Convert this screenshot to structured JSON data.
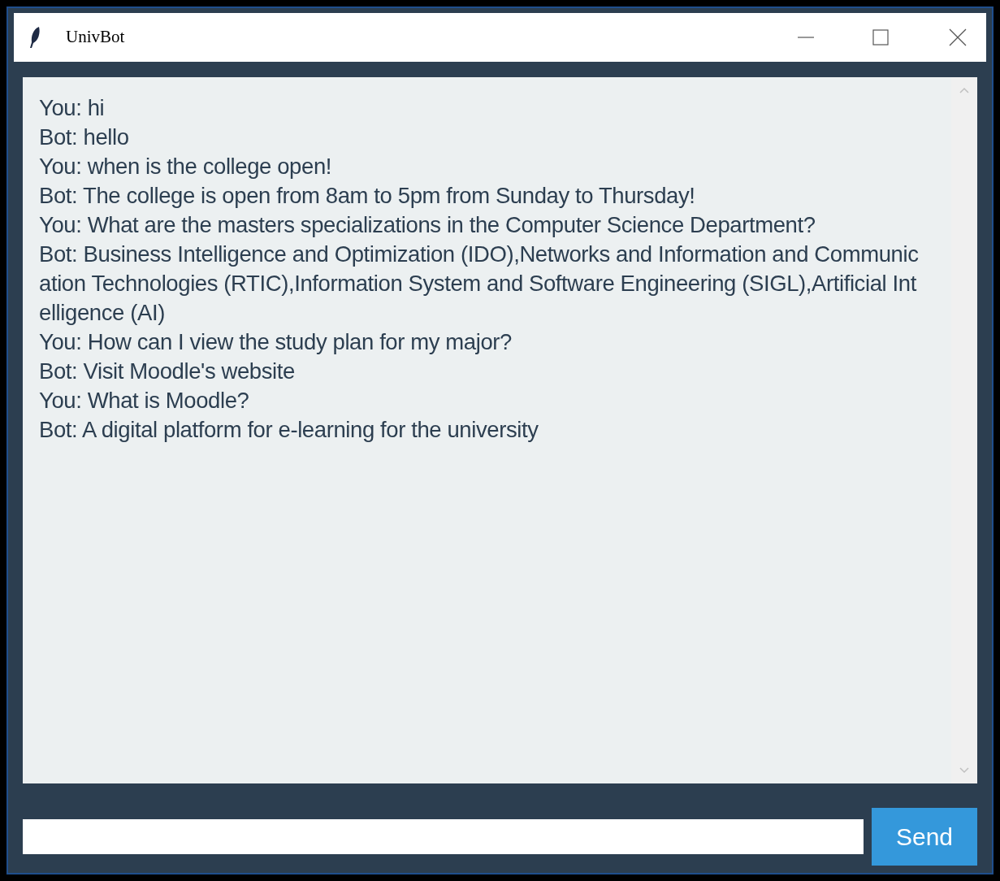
{
  "window": {
    "title": "UnivBot"
  },
  "messages": [
    {
      "text": "You: hi"
    },
    {
      "text": "Bot: hello"
    },
    {
      "text": "You: when is the college open!"
    },
    {
      "text": "Bot: The college is open from 8am to 5pm from Sunday to Thursday!"
    },
    {
      "text": "You: What are the masters specializations in the Computer Science Department?"
    },
    {
      "text": "Bot: Business Intelligence and Optimization (IDO),Networks and Information and Communication Technologies (RTIC),Information System and Software Engineering (SIGL),Artificial Intelligence (AI)"
    },
    {
      "text": "You: How can I view the study plan for my major?"
    },
    {
      "text": "Bot: Visit Moodle's website"
    },
    {
      "text": "You: What is Moodle?"
    },
    {
      "text": "Bot: A digital platform for e-learning for the university"
    }
  ],
  "send_button": {
    "label": "Send"
  }
}
